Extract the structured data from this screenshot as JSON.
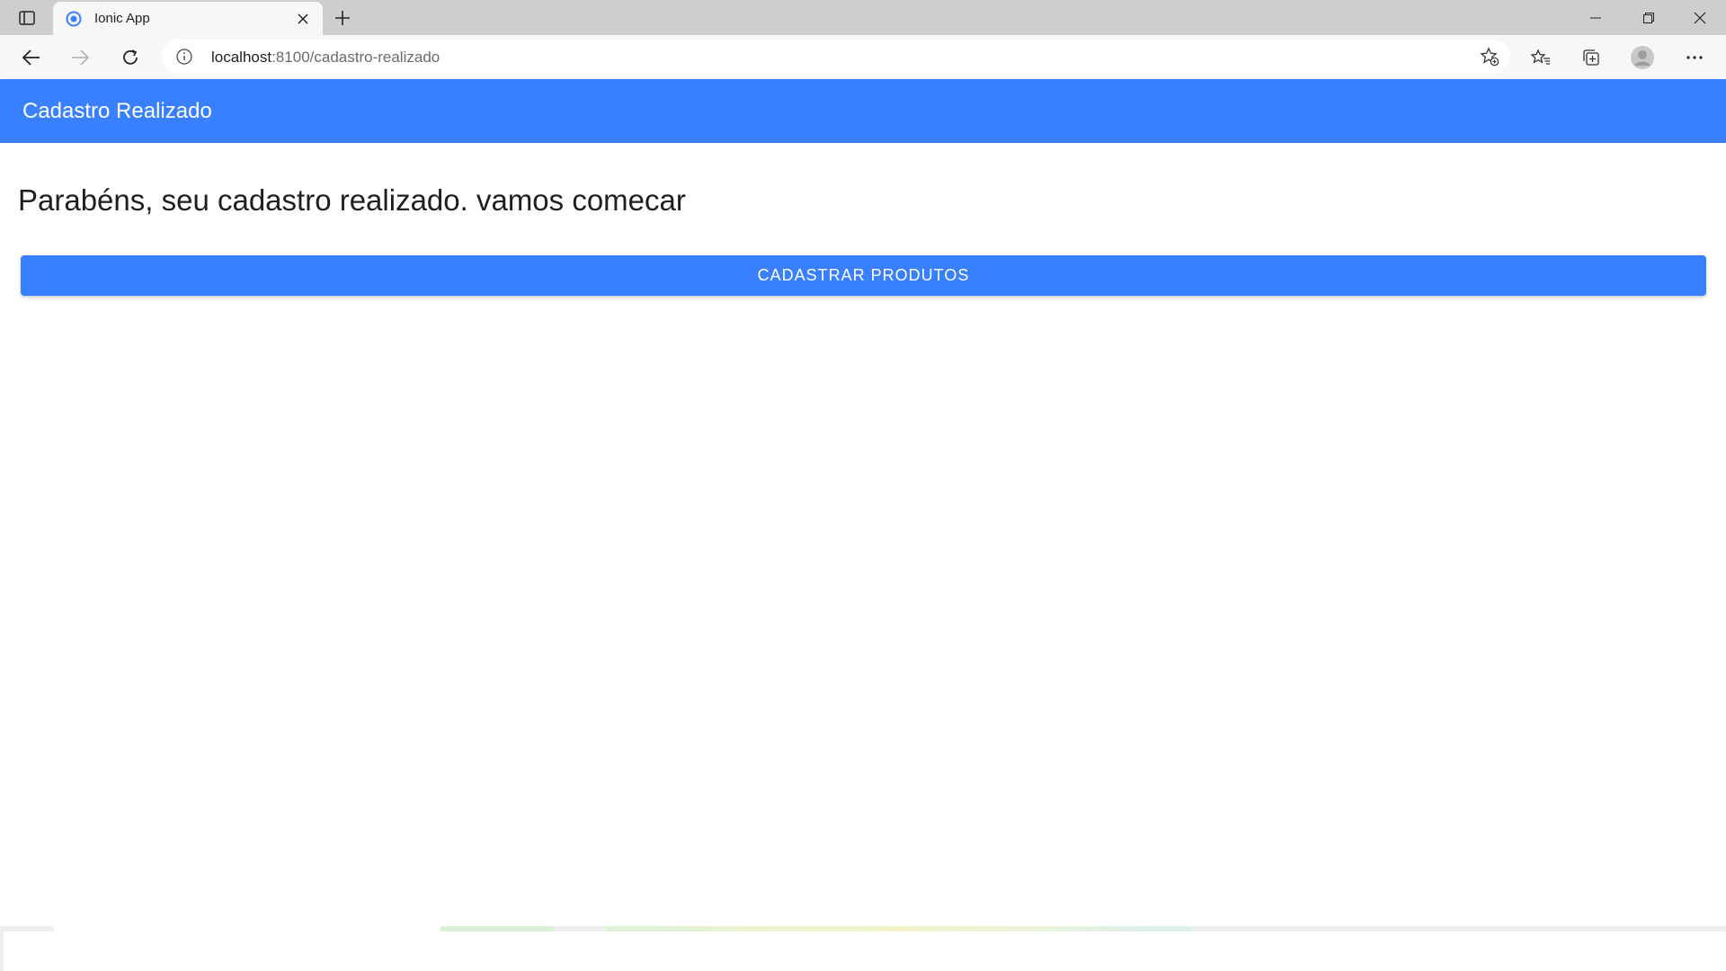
{
  "browser": {
    "tab_title": "Ionic App",
    "url_host": "localhost",
    "url_rest": ":8100/cadastro-realizado",
    "icons": {
      "tab_actions": "tab-actions-icon",
      "favicon": "ionic-favicon",
      "close": "close-icon",
      "new_tab": "plus-icon",
      "back": "back-arrow-icon",
      "forward": "forward-arrow-icon",
      "reload": "reload-icon",
      "info": "info-icon",
      "add_favorite": "star-plus-icon",
      "favorites": "favorites-icon",
      "collections": "collections-icon",
      "profile": "profile-avatar-icon",
      "more": "more-dots-icon"
    }
  },
  "app": {
    "header_title": "Cadastro Realizado",
    "message": "Parabéns, seu cadastro realizado. vamos comecar",
    "button_label": "CADASTRAR PRODUTOS",
    "colors": {
      "primary": "#3880ff",
      "background": "#ffffff",
      "text": "#1f1f1f"
    }
  }
}
